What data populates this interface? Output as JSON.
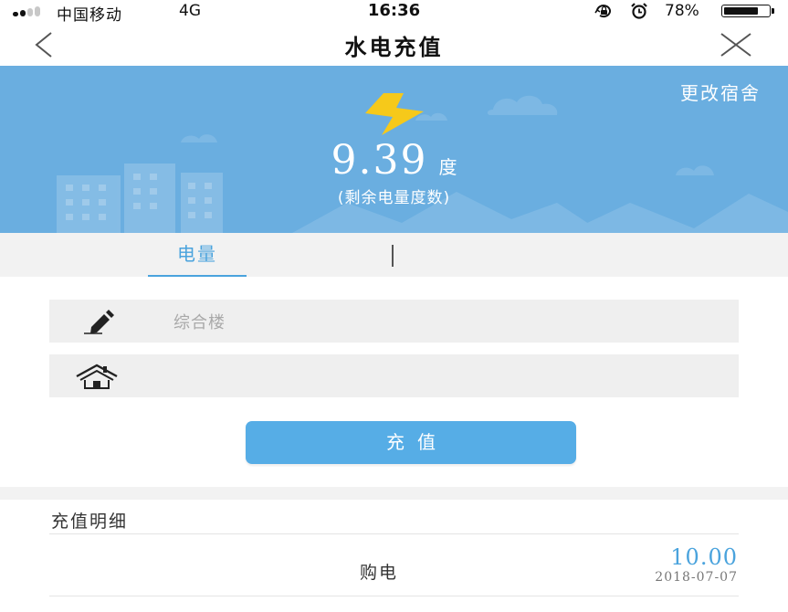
{
  "status_bar": {
    "carrier": "中国移动",
    "network": "4G",
    "time": "16:36",
    "battery_percent": "78%",
    "battery_level": 0.78,
    "signal_bars_filled": 2,
    "signal_bars_total": 4,
    "icons": [
      "orientation-lock-icon",
      "alarm-clock-icon",
      "battery-icon"
    ]
  },
  "nav": {
    "title": "水电充值",
    "back_icon": "chevron-left-icon",
    "close_icon": "close-icon"
  },
  "banner": {
    "change_dorm": "更改宿舍",
    "icon": "lightning-bolt-icon",
    "remaining_value": "9.39",
    "unit": "度",
    "caption": "(剩余电量度数)"
  },
  "tabs": {
    "items": [
      "电量"
    ],
    "active": "电量"
  },
  "form": {
    "building": "综合楼",
    "building_icon": "pencil-icon",
    "room": "",
    "room_icon": "house-icon",
    "submit_label": "充值"
  },
  "details": {
    "title": "充值明细",
    "records": [
      {
        "type": "购电",
        "amount": "10.00",
        "date": "2018-07-07"
      }
    ]
  },
  "colors": {
    "banner_bg": "#6aaee0",
    "accent": "#4aa3dd",
    "button": "#56ade6",
    "bolt": "#f6c91a"
  }
}
